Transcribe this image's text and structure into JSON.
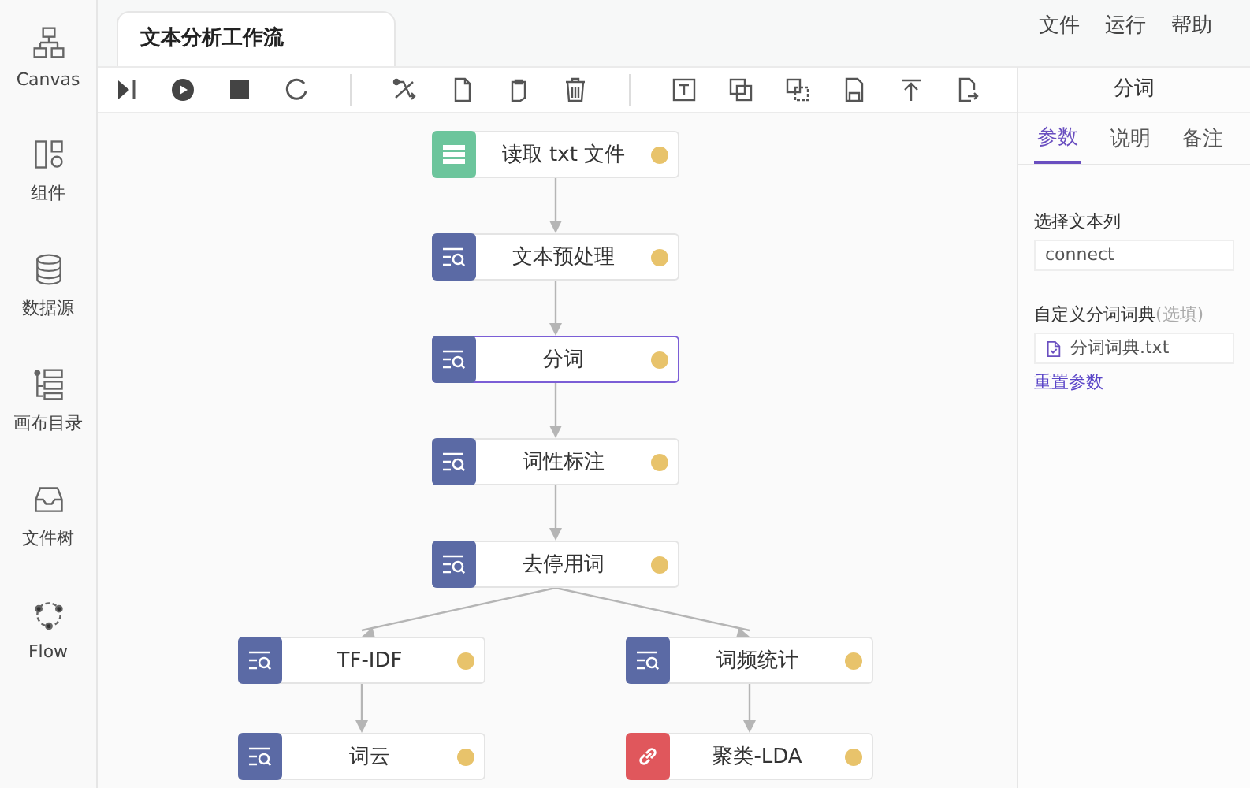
{
  "sidebar": {
    "items": [
      {
        "label": "Canvas"
      },
      {
        "label": "组件"
      },
      {
        "label": "数据源"
      },
      {
        "label": "画布目录"
      },
      {
        "label": "文件树"
      },
      {
        "label": "Flow"
      }
    ]
  },
  "tabs": [
    {
      "label": "文本分析工作流",
      "selected": true
    }
  ],
  "menu": [
    "文件",
    "运行",
    "帮助"
  ],
  "canvas": {
    "nodes": [
      {
        "label": "读取 txt 文件",
        "kind": "data",
        "selected": false
      },
      {
        "label": "文本预处理",
        "kind": "process",
        "selected": false
      },
      {
        "label": "分词",
        "kind": "process",
        "selected": true
      },
      {
        "label": "词性标注",
        "kind": "process",
        "selected": false
      },
      {
        "label": "去停用词",
        "kind": "process",
        "selected": false
      },
      {
        "label": "TF-IDF",
        "kind": "process",
        "selected": false
      },
      {
        "label": "词频统计",
        "kind": "process",
        "selected": false
      },
      {
        "label": "词云",
        "kind": "process",
        "selected": false
      },
      {
        "label": "聚类-LDA",
        "kind": "model",
        "selected": false
      }
    ]
  },
  "panel": {
    "title": "分词",
    "tabs": [
      {
        "label": "参数",
        "selected": true
      },
      {
        "label": "说明",
        "selected": false
      },
      {
        "label": "备注",
        "selected": false
      }
    ],
    "fields": [
      {
        "label": "选择文本列",
        "value": "connect"
      },
      {
        "label": "自定义分词词典",
        "hint": "(选填)",
        "file": "分词词典.txt"
      }
    ],
    "reset": "重置参数"
  }
}
